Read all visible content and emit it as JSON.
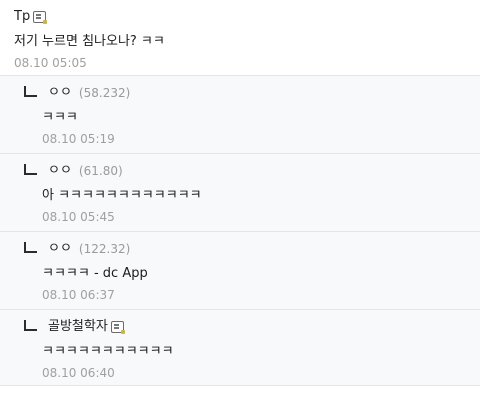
{
  "comment": {
    "nickname": "Tp",
    "member_icon": "member-badge-icon",
    "text": "저기 누르면 침나오나? ㅋㅋ",
    "date": "08.10 05:05"
  },
  "replies": [
    {
      "nickname": "ㅇㅇ",
      "ip": "(58.232)",
      "text": "ㅋㅋㅋ",
      "date": "08.10 05:19"
    },
    {
      "nickname": "ㅇㅇ",
      "ip": "(61.80)",
      "text": "아 ㅋㅋㅋㅋㅋㅋㅋㅋㅋㅋㅋㅋ",
      "date": "08.10 05:45"
    },
    {
      "nickname": "ㅇㅇ",
      "ip": "(122.32)",
      "text": "ㅋㅋㅋㅋ - dc App",
      "date": "08.10 06:37"
    },
    {
      "nickname": "골방철학자",
      "member_icon": "member-badge-icon",
      "text": "ㅋㅋㅋㅋㅋㅋㅋㅋㅋㅋㅋ",
      "date": "08.10 06:40"
    }
  ]
}
